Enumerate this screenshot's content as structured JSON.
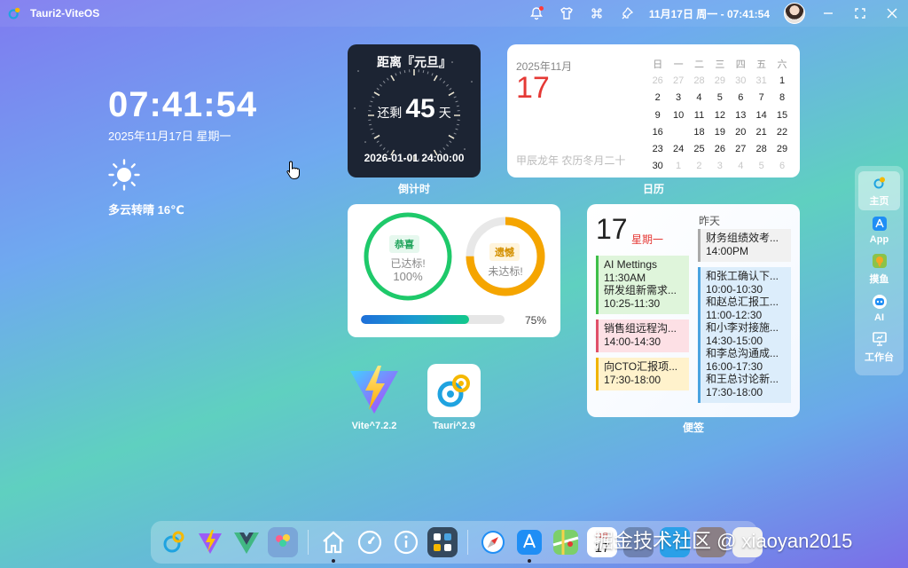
{
  "titlebar": {
    "title": "Tauri2-ViteOS",
    "datetime": "11月17日 周一 - 07:41:54"
  },
  "desktop": {
    "clock": "07:41:54",
    "date": "2025年11月17日 星期一",
    "weather": "多云转晴 16℃"
  },
  "countdown": {
    "title": "距离『元旦』",
    "prefix": "还剩",
    "days": "45",
    "suffix": "天",
    "target": "2026-01-01 24:00:00",
    "label": "倒计时"
  },
  "calendar": {
    "month": "2025年11月",
    "day": "17",
    "lunar": "甲辰龙年 农历冬月二十",
    "label": "日历",
    "weekdays": [
      "日",
      "一",
      "二",
      "三",
      "四",
      "五",
      "六"
    ],
    "weeks": [
      [
        {
          "d": "26",
          "m": true
        },
        {
          "d": "27",
          "m": true
        },
        {
          "d": "28",
          "m": true
        },
        {
          "d": "29",
          "m": true
        },
        {
          "d": "30",
          "m": true
        },
        {
          "d": "31",
          "m": true
        },
        {
          "d": "1"
        }
      ],
      [
        {
          "d": "2"
        },
        {
          "d": "3"
        },
        {
          "d": "4"
        },
        {
          "d": "5"
        },
        {
          "d": "6"
        },
        {
          "d": "7"
        },
        {
          "d": "8"
        }
      ],
      [
        {
          "d": "9"
        },
        {
          "d": "10"
        },
        {
          "d": "11"
        },
        {
          "d": "12"
        },
        {
          "d": "13"
        },
        {
          "d": "14"
        },
        {
          "d": "15"
        }
      ],
      [
        {
          "d": "16"
        },
        {
          "d": "17",
          "t": true
        },
        {
          "d": "18"
        },
        {
          "d": "19"
        },
        {
          "d": "20"
        },
        {
          "d": "21"
        },
        {
          "d": "22"
        }
      ],
      [
        {
          "d": "23"
        },
        {
          "d": "24"
        },
        {
          "d": "25"
        },
        {
          "d": "26"
        },
        {
          "d": "27"
        },
        {
          "d": "28"
        },
        {
          "d": "29"
        }
      ],
      [
        {
          "d": "30"
        },
        {
          "d": "1",
          "m": true
        },
        {
          "d": "2",
          "m": true
        },
        {
          "d": "3",
          "m": true
        },
        {
          "d": "4",
          "m": true
        },
        {
          "d": "5",
          "m": true
        },
        {
          "d": "6",
          "m": true
        }
      ]
    ]
  },
  "progress": {
    "ring1": {
      "badge": "恭喜",
      "status": "已达标!",
      "pct": "100%",
      "value": 1.0,
      "color": "#1ec96a",
      "badge_bg": "#e6f8ee",
      "badge_color": "#1ea35a"
    },
    "ring2": {
      "badge": "遗憾",
      "status": "未达标!",
      "value": 0.75,
      "color": "#f5a500",
      "badge_bg": "#fff4dc",
      "badge_color": "#d49000"
    },
    "bar_value": 0.75,
    "bar_pct": "75%"
  },
  "notes": {
    "day": "17",
    "weekday": "星期一",
    "yesterday": "昨天",
    "label": "便签",
    "today_items": [
      {
        "lines": [
          "AI Mettings",
          "11:30AM",
          "研发组新需求...",
          "10:25-11:30"
        ],
        "border": "#3fbf4a",
        "bg": "#dff5db"
      },
      {
        "lines": [
          "销售组远程沟...",
          "14:00-14:30"
        ],
        "border": "#e0506a",
        "bg": "#fde0e5"
      },
      {
        "lines": [
          "向CTO汇报项...",
          "17:30-18:00"
        ],
        "border": "#f0b400",
        "bg": "#fff2cc"
      }
    ],
    "yesterday_items": [
      {
        "lines": [
          "财务组绩效考...",
          "14:00PM"
        ],
        "border": "#aaaaaa",
        "bg": "#f1f1f1"
      },
      {
        "lines": [
          "和张工确认下...",
          "10:00-10:30",
          "和赵总汇报工...",
          "11:00-12:30",
          "和小李对接施...",
          "14:30-15:00",
          "和李总沟通成...",
          "16:00-17:30",
          "和王总讨论新...",
          "17:30-18:00"
        ],
        "border": "#4aa3e0",
        "bg": "#dcedfb"
      }
    ]
  },
  "apps": [
    {
      "label": "Vite^7.2.2",
      "icon": "vite-logo-icon"
    },
    {
      "label": "Tauri^2.9",
      "icon": "tauri-logo-icon"
    }
  ],
  "sidebar": {
    "items": [
      {
        "label": "主页",
        "icon": "tauri-home-icon"
      },
      {
        "label": "App",
        "icon": "app-store-icon"
      },
      {
        "label": "摸鱼",
        "icon": "fish-icon"
      },
      {
        "label": "AI",
        "icon": "robot-icon"
      },
      {
        "label": "工作台",
        "icon": "presentation-icon"
      }
    ]
  },
  "dock": {
    "calendar_day": "17",
    "calendar_month": "11月"
  },
  "watermark": "掘金技术社区 @ xiaoyan2015",
  "colors": {
    "accent": "#e53935",
    "countdown_bg": "#1c2433"
  }
}
